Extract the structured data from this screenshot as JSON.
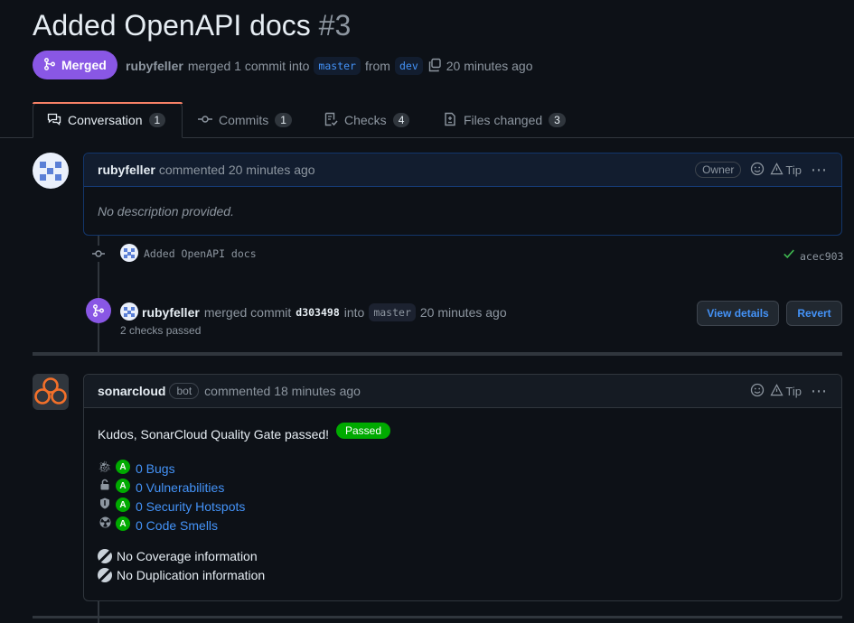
{
  "pr": {
    "title": "Added OpenAPI docs",
    "number": "#3",
    "state": "Merged",
    "author": "rubyfeller",
    "merge_text": "merged 1 commit into",
    "base_branch": "master",
    "from_text": "from",
    "head_branch": "dev",
    "time": "20 minutes ago"
  },
  "tabs": [
    {
      "label": "Conversation",
      "count": "1",
      "icon": "comment-discussion-icon"
    },
    {
      "label": "Commits",
      "count": "1",
      "icon": "git-commit-icon"
    },
    {
      "label": "Checks",
      "count": "4",
      "icon": "checklist-icon"
    },
    {
      "label": "Files changed",
      "count": "3",
      "icon": "file-diff-icon"
    }
  ],
  "comment1": {
    "author": "rubyfeller",
    "action": "commented 20 minutes ago",
    "role": "Owner",
    "tip": "Tip",
    "body": "No description provided."
  },
  "commit": {
    "message": "Added OpenAPI docs",
    "sha": "acec903"
  },
  "merge_event": {
    "author": "rubyfeller",
    "text": "merged commit",
    "sha": "d303498",
    "into": "into",
    "branch": "master",
    "time": "20 minutes ago",
    "checks": "2 checks passed",
    "view_details": "View details",
    "revert": "Revert"
  },
  "comment2": {
    "author": "sonarcloud",
    "badge": "bot",
    "action": "commented 18 minutes ago",
    "tip": "Tip",
    "headline": "Kudos, SonarCloud Quality Gate passed!",
    "status": "Passed",
    "metrics": [
      {
        "icon": "bug-icon",
        "grade": "A",
        "label": "0 Bugs"
      },
      {
        "icon": "lock-icon",
        "grade": "A",
        "label": "0 Vulnerabilities"
      },
      {
        "icon": "shield-icon",
        "grade": "A",
        "label": "0 Security Hotspots"
      },
      {
        "icon": "radiation-icon",
        "grade": "A",
        "label": "0 Code Smells"
      }
    ],
    "coverage": "No Coverage information",
    "duplication": "No Duplication information"
  },
  "colors": {
    "merged": "#8957e5",
    "link": "#4493f8",
    "passed": "#00aa00",
    "sonar": "#f3702a"
  }
}
